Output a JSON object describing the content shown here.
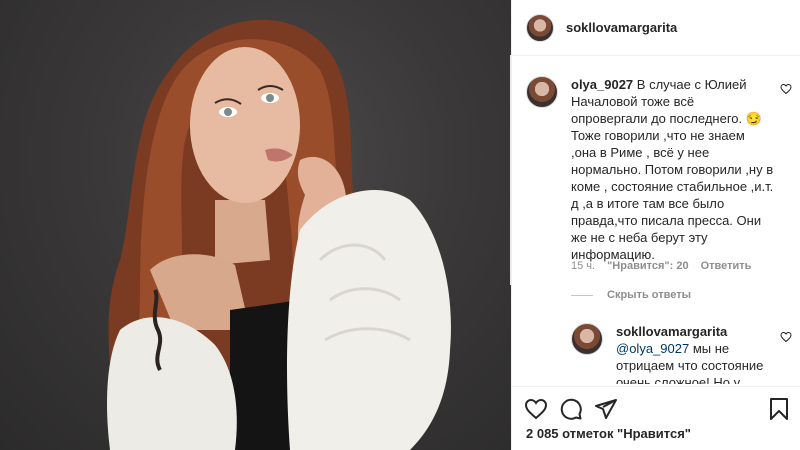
{
  "post": {
    "author": "sokllovamargarita"
  },
  "comments": [
    {
      "username": "olya_9027",
      "lines": [
        "В случае с Юлией",
        "Началовой тоже всё",
        "опровергали до последнего. 😏",
        "Тоже говорили ,что не знаем",
        ",она в Риме , всё у нее",
        "нормально. Потом говорили ,ну в",
        "коме , состояние стабильное ,и.т.",
        "д ,а в итоге там все было",
        "правда,что писала пресса. Они",
        "же не с неба берут эту",
        "информацию."
      ],
      "time": "15 ч.",
      "likes": "\"Нравится\": 20",
      "reply": "Ответить"
    }
  ],
  "hide_replies": "Скрыть ответы",
  "reply": {
    "username": "sokllovamargarita",
    "mention": "@olya_9027",
    "lines": [
      " мы не",
      "отрицаем что состояние",
      "очень сложное! Но у"
    ]
  },
  "footer": {
    "likes_count": "2 085 отметок \"Нравится\""
  },
  "icons": [
    "heart-icon",
    "comment-icon",
    "share-icon",
    "bookmark-icon"
  ]
}
